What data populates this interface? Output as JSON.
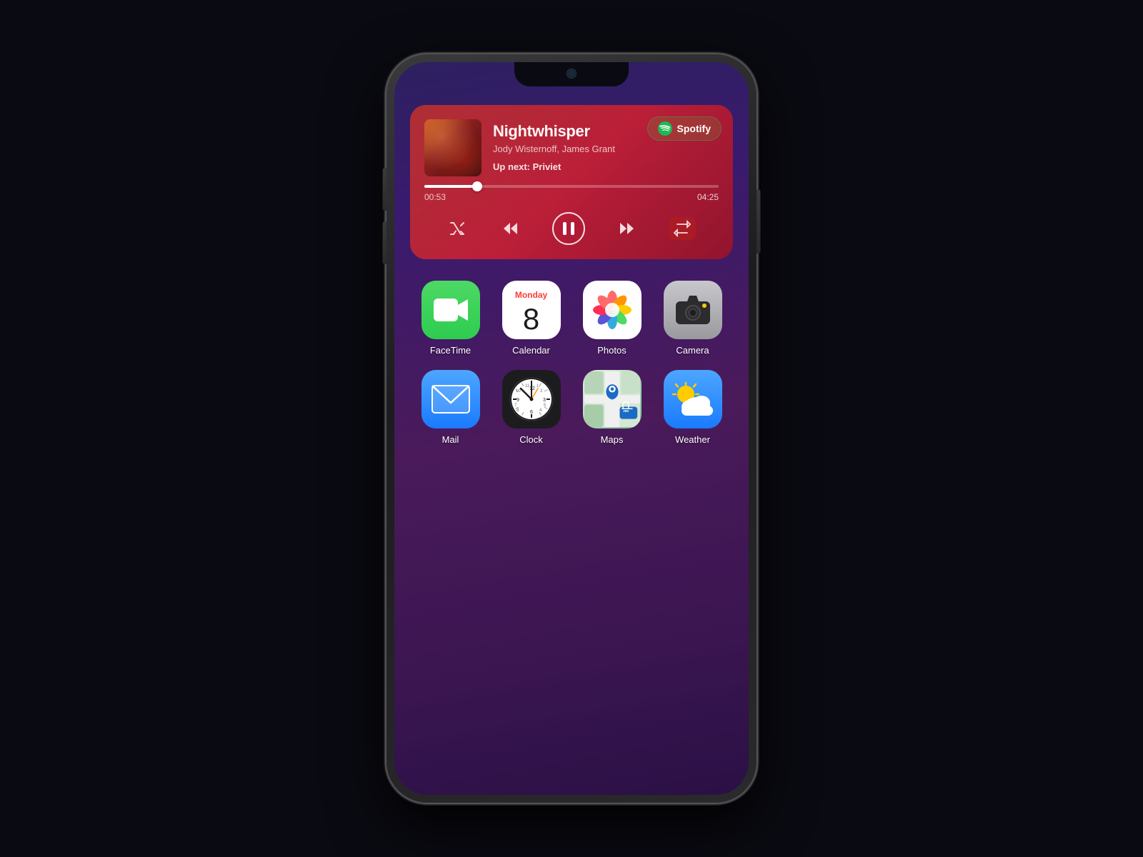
{
  "page": {
    "background_color": "#0a0a12"
  },
  "music_card": {
    "track_title": "Nightwhisper",
    "track_artist": "Jody Wisternoff, James Grant",
    "up_next_label": "Up next: Priviet",
    "time_current": "00:53",
    "time_total": "04:25",
    "progress_percent": 18,
    "spotify_label": "Spotify"
  },
  "apps_row1": [
    {
      "id": "facetime",
      "label": "FaceTime"
    },
    {
      "id": "calendar",
      "label": "Calendar",
      "day": "Monday",
      "date": "8"
    },
    {
      "id": "photos",
      "label": "Photos"
    },
    {
      "id": "camera",
      "label": "Camera"
    }
  ],
  "apps_row2": [
    {
      "id": "mail",
      "label": "Mail"
    },
    {
      "id": "clock",
      "label": "Clock"
    },
    {
      "id": "maps",
      "label": "Maps"
    },
    {
      "id": "weather",
      "label": "Weather"
    }
  ],
  "controls": {
    "shuffle": "⇄",
    "rewind": "«",
    "pause": "⏸",
    "forward": "»",
    "repeat": "↺"
  }
}
